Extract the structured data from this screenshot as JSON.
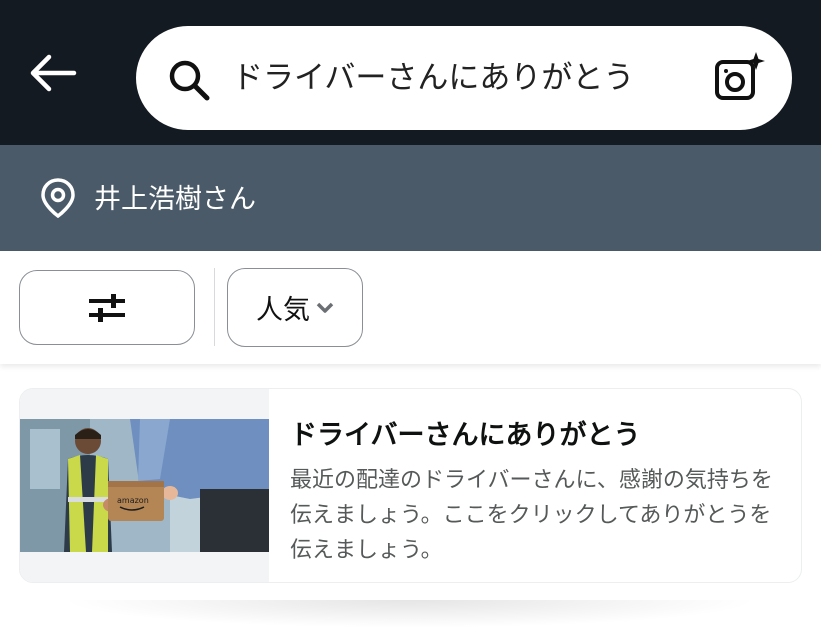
{
  "header": {
    "back_icon": "arrow-left-icon",
    "search": {
      "value": "ドライバーさんにありがとう",
      "placeholder": "",
      "search_icon": "search-icon",
      "camera_icon": "camera-sparkle-icon"
    }
  },
  "location": {
    "icon": "location-pin-icon",
    "text": "井上浩樹さん"
  },
  "filters": {
    "filter_icon": "sliders-icon",
    "sort_label": "人気",
    "sort_chevron": "chevron-down-icon"
  },
  "results": [
    {
      "title": "ドライバーさんにありがとう",
      "description": "最近の配達のドライバーさんに、感謝の気持ちを伝えましょう。ここをクリックしてありがとうを伝えましょう。",
      "box_label": "amazon"
    }
  ],
  "colors": {
    "topbar": "#131a22",
    "location_bar": "#4a5a68",
    "vest": "#c9d94a",
    "box": "#b58655"
  }
}
